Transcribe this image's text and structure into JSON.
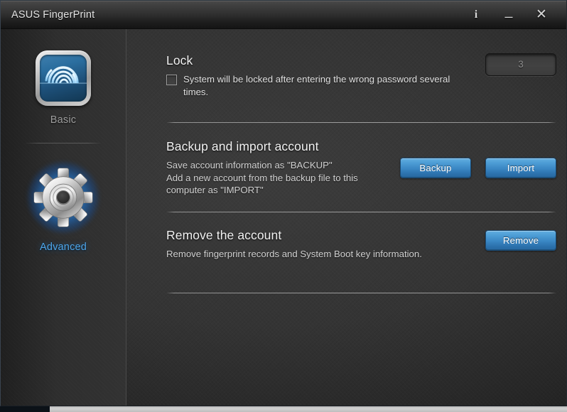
{
  "window": {
    "title_brand": "ASUS",
    "title_app": "FingerPrint",
    "controls": {
      "info": "i",
      "minimize": "_",
      "close": "✕"
    }
  },
  "sidebar": {
    "items": [
      {
        "label": "Basic",
        "icon": "fingerprint-icon",
        "active": false
      },
      {
        "label": "Advanced",
        "icon": "gear-icon",
        "active": true
      }
    ]
  },
  "content": {
    "sections": [
      {
        "id": "lock",
        "title": "Lock",
        "checkbox_label": "System will be locked after entering the wrong password several times.",
        "checkbox_checked": false,
        "attempts_value": "3"
      },
      {
        "id": "backup-import",
        "title": "Backup and import account",
        "description": "Save account information as \"BACKUP\"\nAdd a new account from the backup file to this computer as \"IMPORT\"",
        "desc_line1": "Save account information as \"BACKUP\"",
        "desc_line2": "Add a new account from the backup file to this",
        "desc_line3": "computer as \"IMPORT\"",
        "buttons": [
          {
            "label": "Backup"
          },
          {
            "label": "Import"
          }
        ]
      },
      {
        "id": "remove-account",
        "title": "Remove the account",
        "description": "Remove fingerprint records and System Boot key information.",
        "buttons": [
          {
            "label": "Remove"
          }
        ]
      }
    ]
  },
  "colors": {
    "accent_blue": "#4ea6ea",
    "button_blue_top": "#63aee0",
    "button_blue_bottom": "#27689f",
    "panel_bg": "#343434",
    "sidebar_bg": "#2e2e2e",
    "titlebar_bg": "#303030",
    "text_primary": "#f2f2f2",
    "text_secondary": "#d2d2d2",
    "text_muted": "#9d9d9d"
  }
}
